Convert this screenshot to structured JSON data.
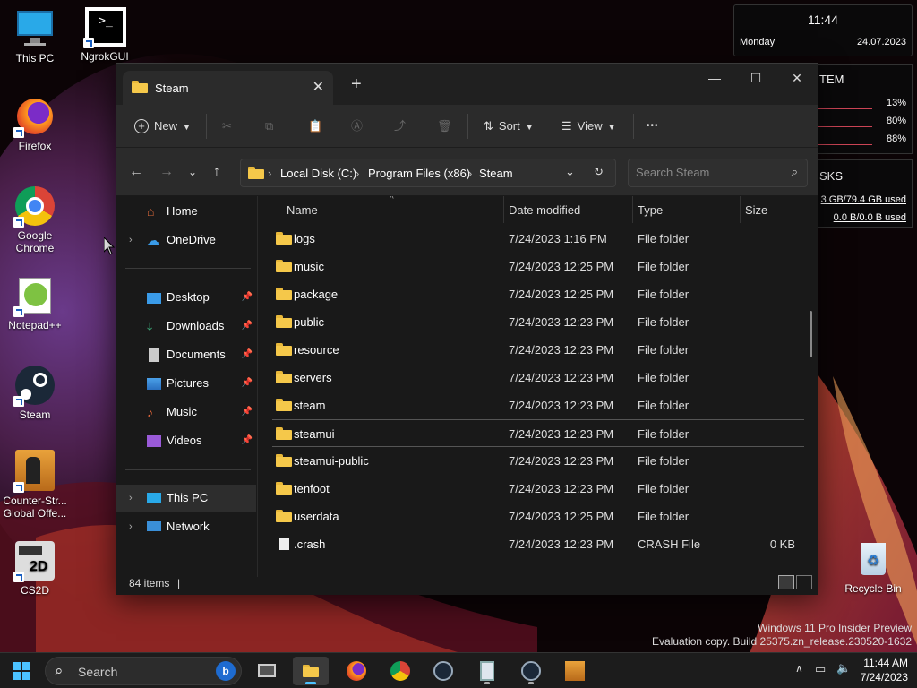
{
  "desktop": {
    "icons": [
      {
        "label": "This PC",
        "icon": "this-pc-icon"
      },
      {
        "label": "NgrokGUI",
        "icon": "console-icon"
      },
      {
        "label": "Firefox",
        "icon": "firefox-icon"
      },
      {
        "label": "Google Chrome",
        "icon": "chrome-icon"
      },
      {
        "label": "Notepad++",
        "icon": "notepad-plus-plus-icon"
      },
      {
        "label": "Steam",
        "icon": "steam-icon"
      },
      {
        "label": "Counter-Str... Global Offe...",
        "icon": "csgo-icon"
      },
      {
        "label": "CS2D",
        "icon": "cs2d-icon"
      },
      {
        "label": "Recycle Bin",
        "icon": "recycle-bin-icon"
      }
    ]
  },
  "widgets": {
    "clock": {
      "time": "11:44",
      "day": "Monday",
      "date": "24.07.2023"
    },
    "system": {
      "heading": "TEM",
      "cpu": "13%",
      "ram": "80%",
      "disk": "88%"
    },
    "disks": {
      "heading": "SKS",
      "usage": "3 GB/79.4 GB used",
      "net": "0.0 B/0.0 B used"
    }
  },
  "explorer": {
    "tab_title": "Steam",
    "toolbar": {
      "new_label": "New",
      "sort_label": "Sort",
      "view_label": "View",
      "more_label": "•••"
    },
    "breadcrumb": {
      "root": "Local Disk (C:)",
      "mid": "Program Files (x86)",
      "leaf": "Steam"
    },
    "search_placeholder": "Search Steam",
    "nav": {
      "home": "Home",
      "onedrive": "OneDrive",
      "desktop": "Desktop",
      "downloads": "Downloads",
      "documents": "Documents",
      "pictures": "Pictures",
      "music": "Music",
      "videos": "Videos",
      "this_pc": "This PC",
      "network": "Network"
    },
    "columns": {
      "name": "Name",
      "date": "Date modified",
      "type": "Type",
      "size": "Size"
    },
    "files": [
      {
        "name": "logs",
        "date": "7/24/2023 1:16 PM",
        "type": "File folder",
        "size": ""
      },
      {
        "name": "music",
        "date": "7/24/2023 12:25 PM",
        "type": "File folder",
        "size": ""
      },
      {
        "name": "package",
        "date": "7/24/2023 12:25 PM",
        "type": "File folder",
        "size": ""
      },
      {
        "name": "public",
        "date": "7/24/2023 12:23 PM",
        "type": "File folder",
        "size": ""
      },
      {
        "name": "resource",
        "date": "7/24/2023 12:23 PM",
        "type": "File folder",
        "size": ""
      },
      {
        "name": "servers",
        "date": "7/24/2023 12:23 PM",
        "type": "File folder",
        "size": ""
      },
      {
        "name": "steam",
        "date": "7/24/2023 12:23 PM",
        "type": "File folder",
        "size": ""
      },
      {
        "name": "steamui",
        "date": "7/24/2023 12:23 PM",
        "type": "File folder",
        "size": ""
      },
      {
        "name": "steamui-public",
        "date": "7/24/2023 12:23 PM",
        "type": "File folder",
        "size": ""
      },
      {
        "name": "tenfoot",
        "date": "7/24/2023 12:23 PM",
        "type": "File folder",
        "size": ""
      },
      {
        "name": "userdata",
        "date": "7/24/2023 12:25 PM",
        "type": "File folder",
        "size": ""
      },
      {
        "name": ".crash",
        "date": "7/24/2023 12:23 PM",
        "type": "CRASH File",
        "size": "0 KB"
      }
    ],
    "status": "84 items"
  },
  "watermark": {
    "line1": "Windows 11 Pro Insider Preview",
    "line2": "Evaluation copy. Build 25375.zn_release.230520-1632"
  },
  "taskbar": {
    "search_label": "Search",
    "time": "11:44 AM",
    "date": "7/24/2023"
  },
  "colors": {
    "accent": "#f5c84a",
    "window_bg": "#191919",
    "toolbar_bg": "#2b2b2b"
  }
}
